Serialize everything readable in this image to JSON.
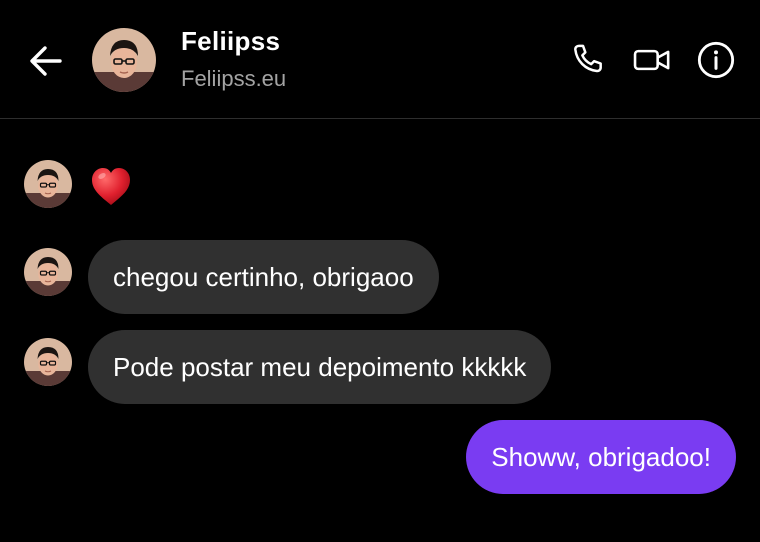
{
  "header": {
    "name": "Feliipss",
    "handle": "Feliipss.eu"
  },
  "icons": {
    "back": "arrow-left-icon",
    "call": "phone-icon",
    "video": "video-camera-icon",
    "info": "info-icon",
    "reaction": "heart-emoji"
  },
  "colors": {
    "background": "#000000",
    "incoming_bubble": "#303030",
    "outgoing_bubble": "#7a3cf2",
    "heart": "#e0202e"
  },
  "messages": [
    {
      "from": "contact",
      "type": "emoji",
      "content": "heart"
    },
    {
      "from": "contact",
      "type": "text",
      "text": "chegou certinho, obrigaoo"
    },
    {
      "from": "contact",
      "type": "text",
      "text": "Pode postar meu depoimento kkkkk"
    },
    {
      "from": "me",
      "type": "text",
      "text": "Showw, obrigadoo!"
    }
  ]
}
